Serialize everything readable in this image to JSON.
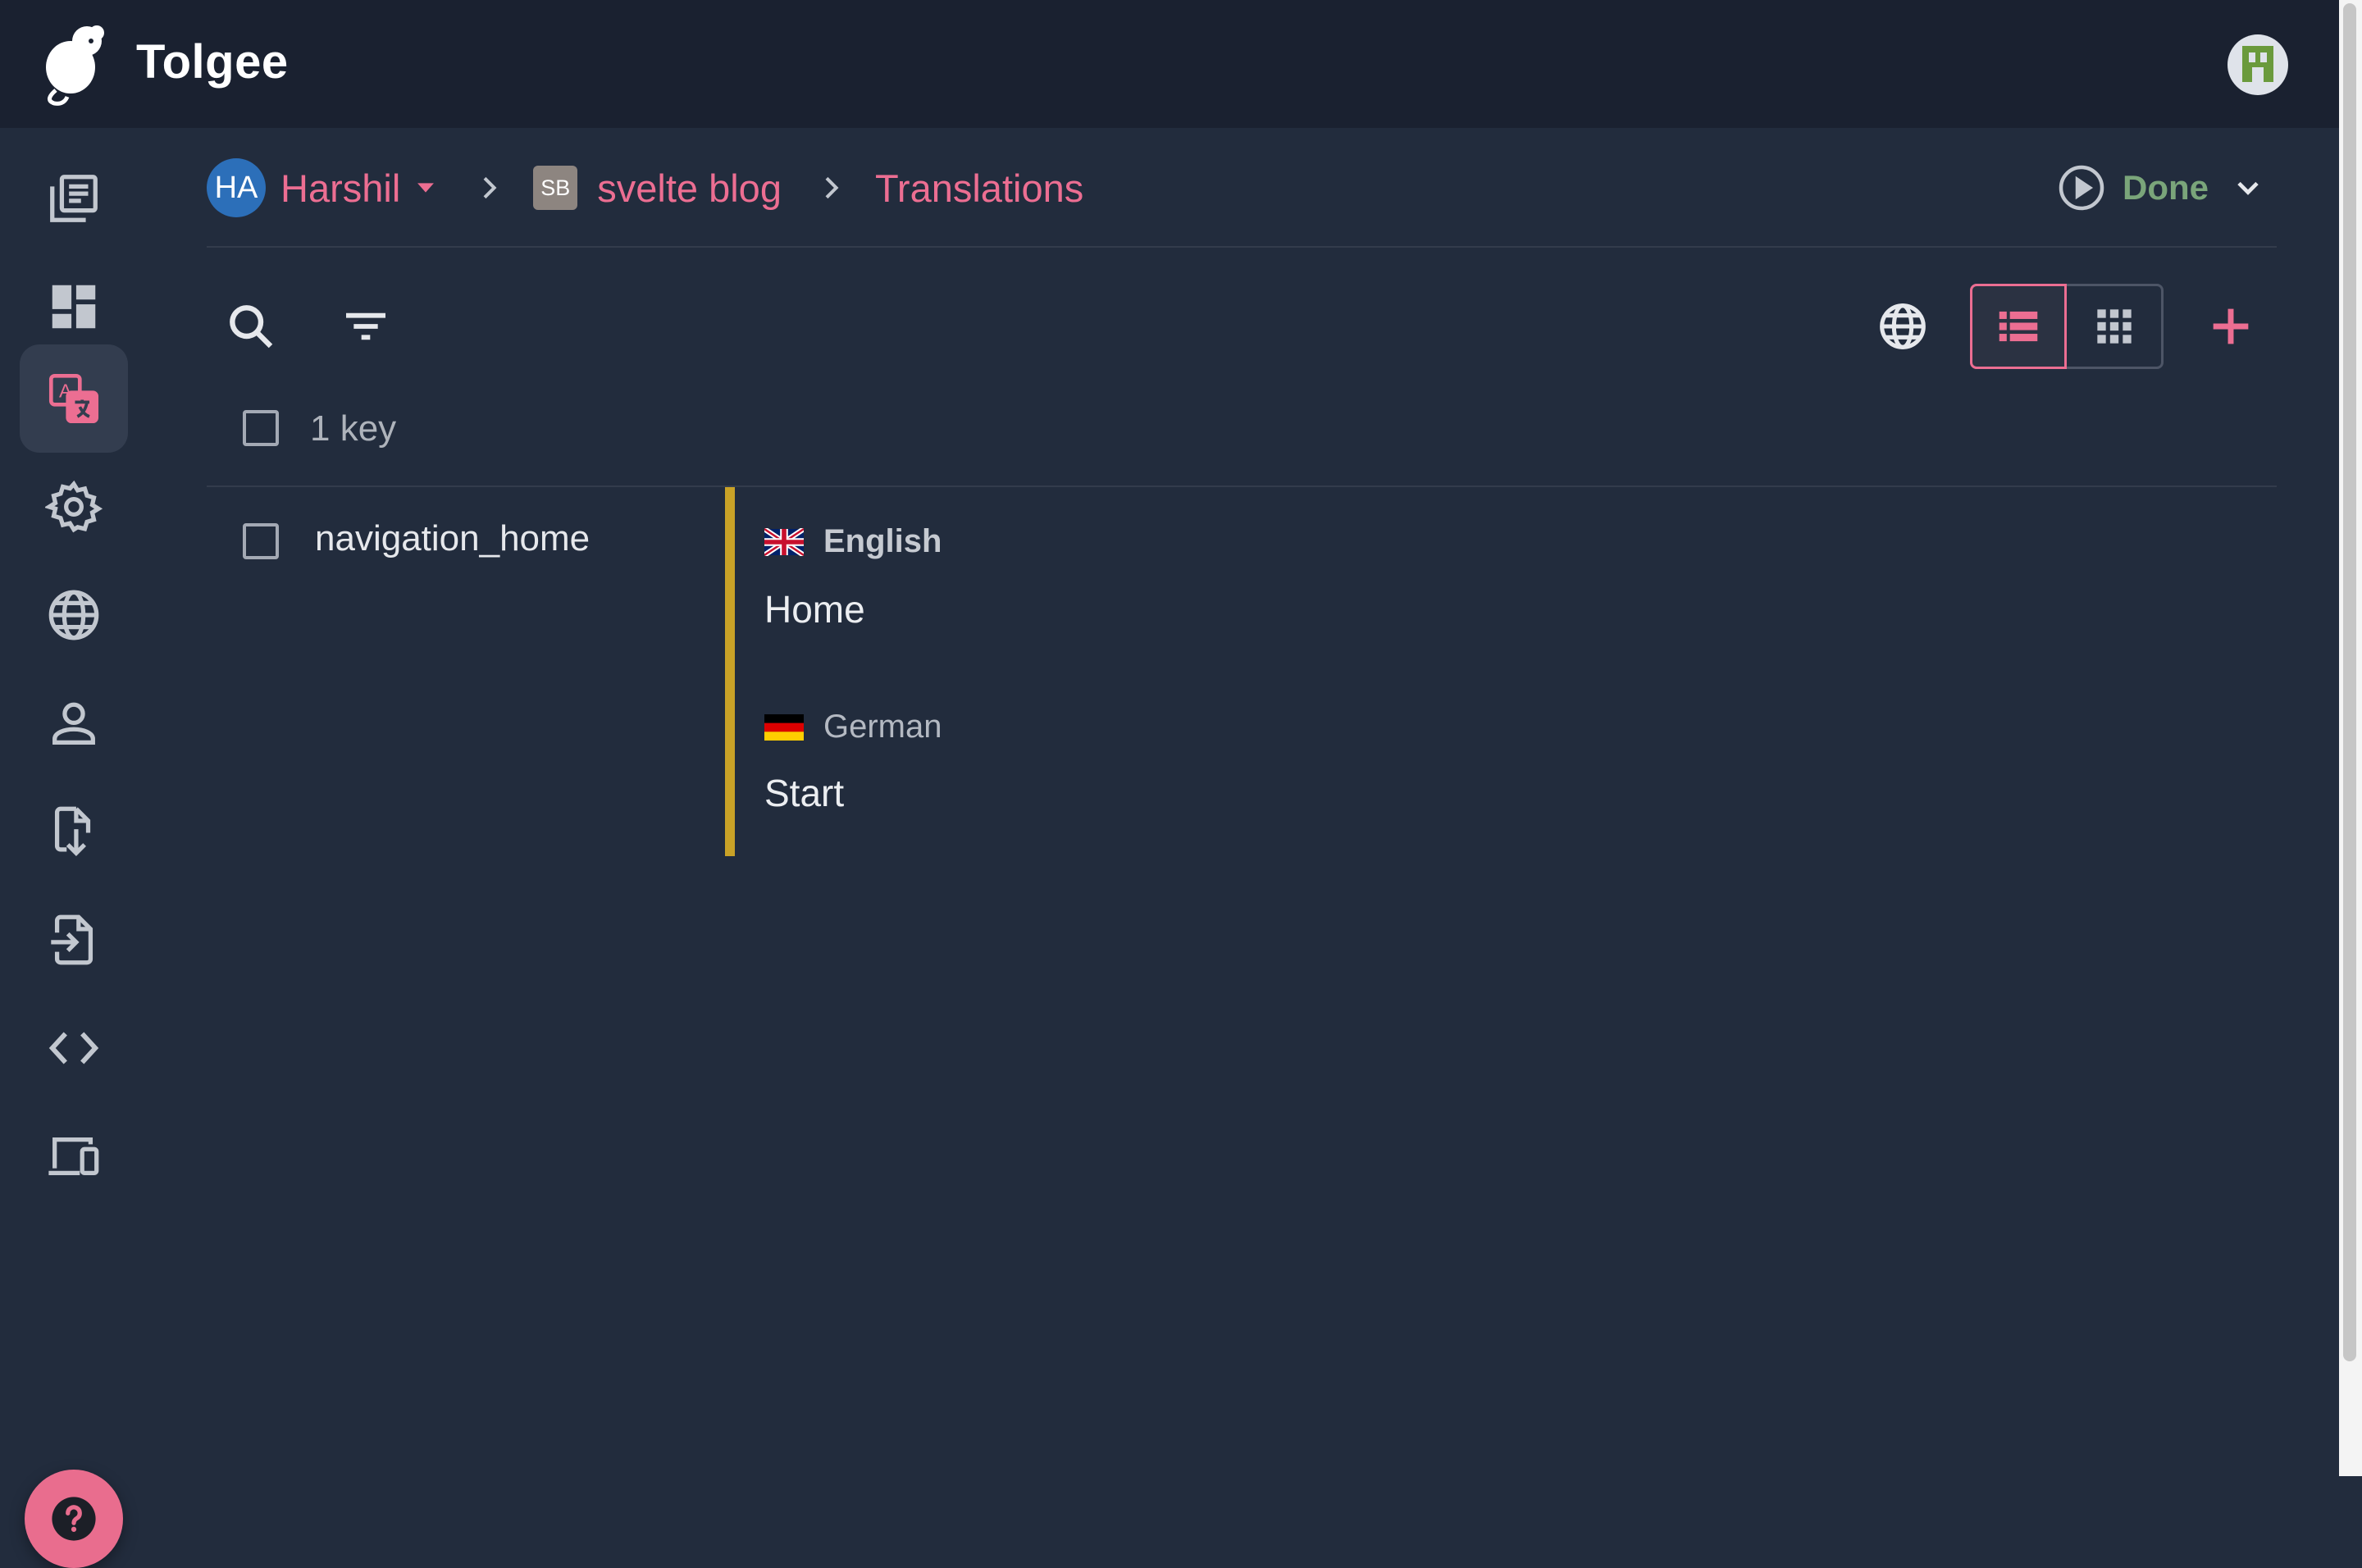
{
  "app": {
    "name": "Tolgee"
  },
  "breadcrumb": {
    "org_initials": "HA",
    "org_name": "Harshil",
    "project_initials": "SB",
    "project_name": "svelte blog",
    "page": "Translations"
  },
  "task": {
    "label": "Done"
  },
  "toolbar": {
    "icons": [
      "search-icon",
      "filter-icon",
      "globe-icon",
      "list-view-icon",
      "grid-view-icon",
      "add-icon"
    ]
  },
  "list": {
    "count_label": "1 key"
  },
  "keys": [
    {
      "name": "navigation_home",
      "translations": [
        {
          "language": "English",
          "flag": "uk-flag-icon",
          "text": "Home"
        },
        {
          "language": "German",
          "flag": "de-flag-icon",
          "text": "Start"
        }
      ]
    }
  ],
  "sidebar": {
    "items": [
      "projects-icon",
      "dashboard-icon",
      "translate-icon",
      "settings-icon",
      "languages-icon",
      "members-icon",
      "import-icon",
      "export-icon",
      "developer-icon",
      "integrate-icon"
    ],
    "active": "translate-icon"
  },
  "colors": {
    "accent": "#ec6e92",
    "background": "#222c3d",
    "topbar": "#1a2130",
    "done": "#7aa57a",
    "state_bar": "#c9a227"
  }
}
